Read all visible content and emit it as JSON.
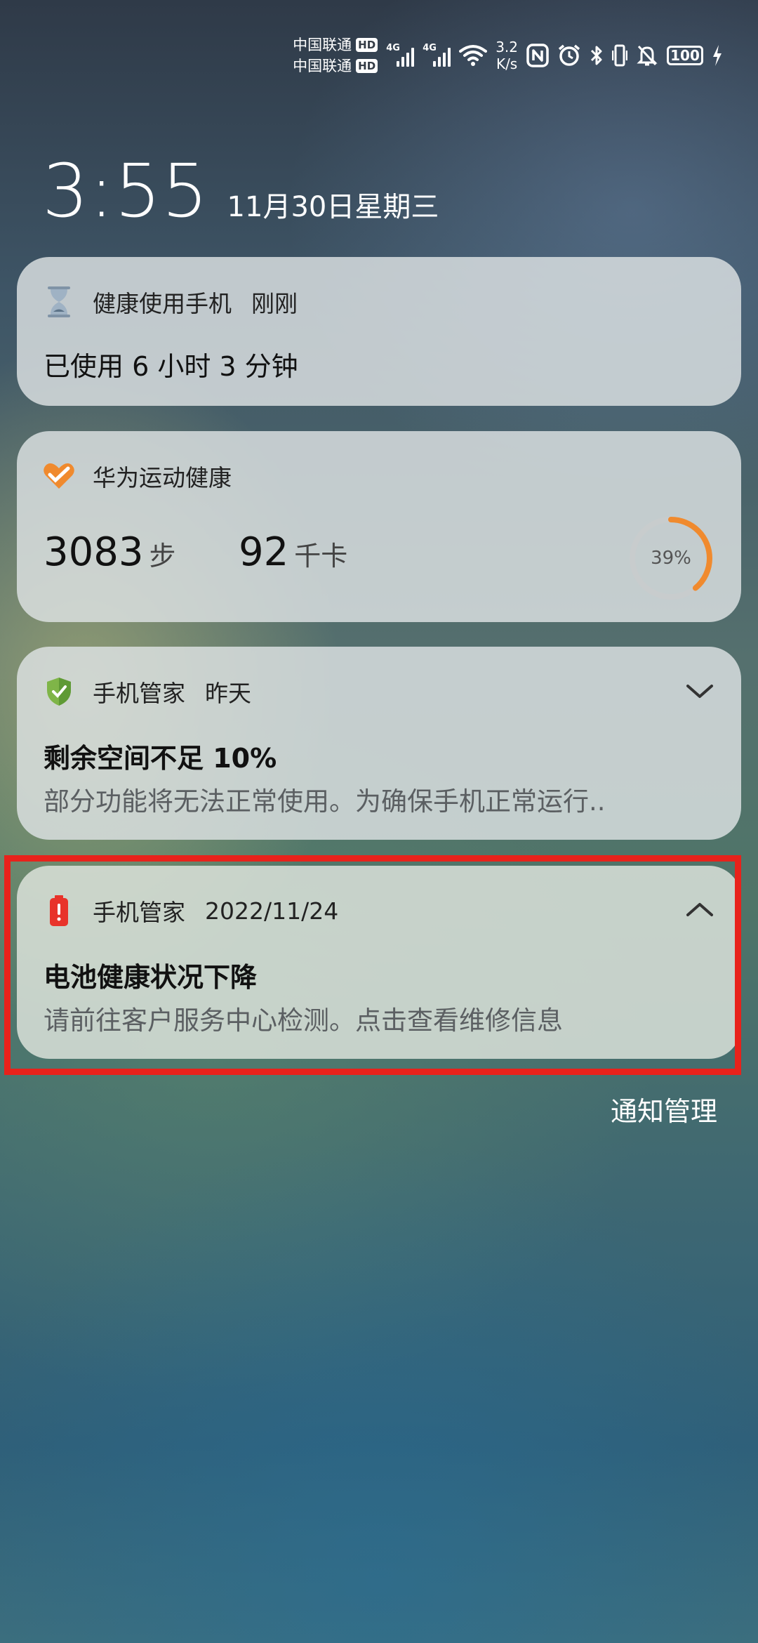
{
  "status_bar": {
    "carrier_1": "中国联通",
    "carrier_2": "中国联通",
    "hd_label": "HD",
    "network_1": "4G",
    "network_2": "4G",
    "speed_value": "3.2",
    "speed_unit": "K/s",
    "battery_level": "100",
    "icons": [
      "nfc-icon",
      "alarm-icon",
      "bluetooth-icon",
      "vibrate-icon",
      "mute-icon",
      "battery-icon",
      "charging-icon"
    ]
  },
  "lockscreen": {
    "time": "3:55",
    "date": "11月30日星期三"
  },
  "notifications": [
    {
      "app": "健康使用手机",
      "time": "刚刚",
      "title": "已使用 6 小时 3 分钟",
      "icon": "hourglass-icon"
    },
    {
      "app": "华为运动健康",
      "icon": "heart-icon",
      "steps_value": "3083",
      "steps_unit": "步",
      "calories_value": "92",
      "calories_unit": "千卡",
      "progress_label": "39%",
      "progress": 0.39
    },
    {
      "app": "手机管家",
      "time": "昨天",
      "title": "剩余空间不足 10%",
      "body": "部分功能将无法正常使用。为确保手机正常运行..",
      "icon": "shield-icon",
      "expand_icon": "chevron-down-icon"
    },
    {
      "app": "手机管家",
      "time": "2022/11/24",
      "title": "电池健康状况下降",
      "body": "请前往客户服务中心检测。点击查看维修信息",
      "icon": "battery-alert-icon",
      "expand_icon": "chevron-up-icon"
    }
  ],
  "footer": {
    "manage_label": "通知管理"
  },
  "colors": {
    "highlight": "#e8221b",
    "health_accent": "#f08a2e",
    "battery_alert": "#e8332a"
  }
}
